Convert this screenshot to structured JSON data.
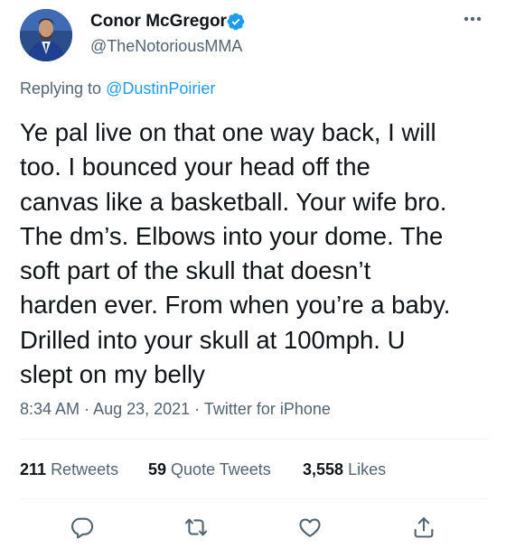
{
  "author": {
    "display_name": "Conor McGregor",
    "handle": "@TheNotoriousMMA",
    "verified": true,
    "avatar_icon": "profile-photo"
  },
  "reply": {
    "prefix": "Replying to ",
    "mention": "@DustinPoirier"
  },
  "tweet": {
    "lines": [
      "Ye pal live on that one way back, I will",
      "too. I bounced your head off the",
      "canvas like a basketball. Your wife bro.",
      "The dm’s. Elbows into your dome. The",
      "soft part of the skull that doesn’t",
      "harden ever. From when you’re a baby.",
      "Drilled into your skull at 100mph. U",
      "slept on my belly"
    ]
  },
  "meta": {
    "time": "8:34 AM",
    "sep1": " · ",
    "date": "Aug 23, 2021",
    "sep2": " · ",
    "source": "Twitter for iPhone"
  },
  "stats": {
    "retweets_count": "211",
    "retweets_label": "Retweets",
    "quotes_count": "59",
    "quotes_label": "Quote Tweets",
    "likes_count": "3,558",
    "likes_label": "Likes"
  },
  "actions": {
    "icons": [
      "reply-icon",
      "retweet-icon",
      "like-icon",
      "share-icon"
    ]
  },
  "colors": {
    "text": "#0f1419",
    "secondary": "#536471",
    "link": "#1d9bf0",
    "divider": "#eff3f4"
  }
}
